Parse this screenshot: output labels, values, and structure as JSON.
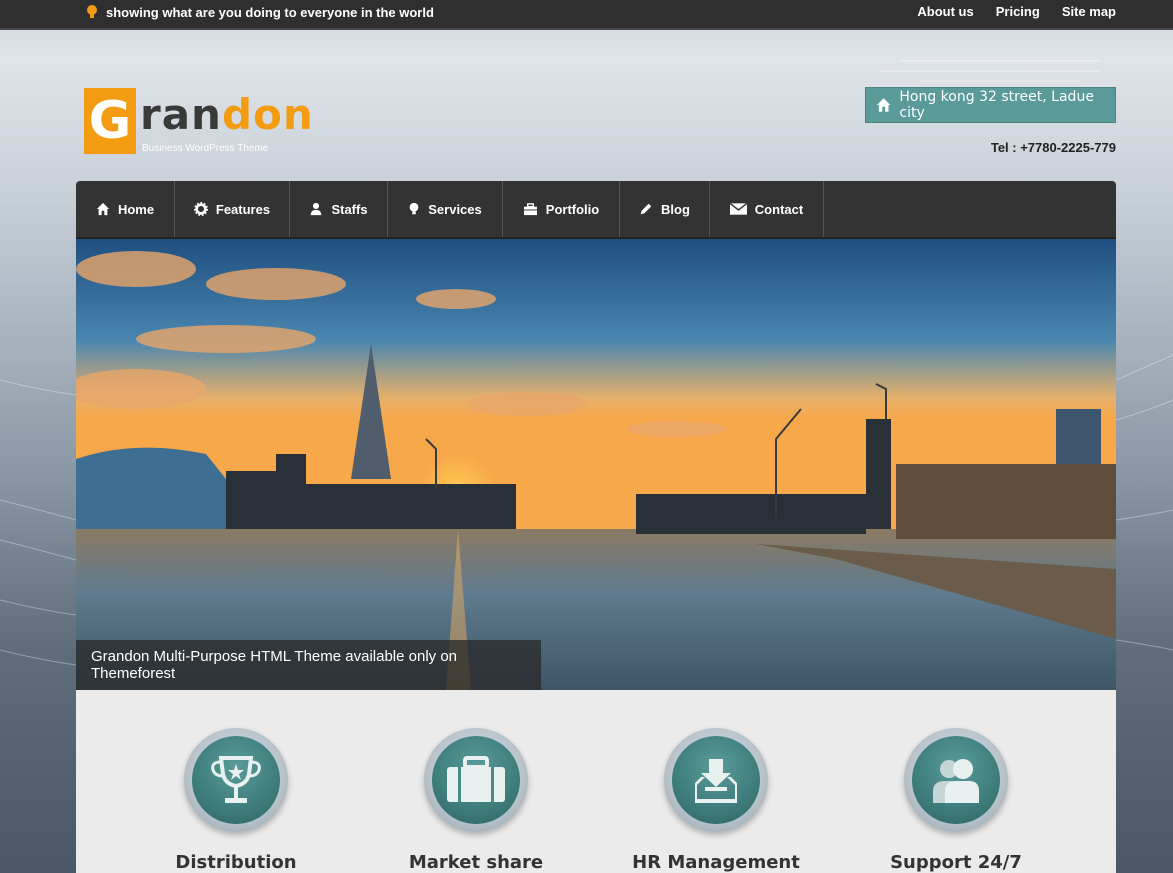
{
  "topbar": {
    "tagline": "showing what are you doing to everyone in the world",
    "links": [
      "About us",
      "Pricing",
      "Site map"
    ]
  },
  "logo": {
    "letter": "G",
    "text_dark": "ran",
    "text_accent": "don",
    "subtitle": "Business WordPress Theme"
  },
  "header": {
    "address": "Hong kong 32 street, Ladue city",
    "tel": "Tel : +7780-2225-779"
  },
  "nav": {
    "items": [
      {
        "label": "Home",
        "icon": "home-icon"
      },
      {
        "label": "Features",
        "icon": "gear-icon"
      },
      {
        "label": "Staffs",
        "icon": "user-icon"
      },
      {
        "label": "Services",
        "icon": "bulb-icon"
      },
      {
        "label": "Portfolio",
        "icon": "briefcase-icon"
      },
      {
        "label": "Blog",
        "icon": "pencil-icon"
      },
      {
        "label": "Contact",
        "icon": "envelope-icon"
      }
    ]
  },
  "hero": {
    "caption": "Grandon Multi-Purpose HTML Theme available only on Themeforest"
  },
  "features": [
    {
      "label": "Distribution",
      "icon": "trophy-icon"
    },
    {
      "label": "Market share",
      "icon": "suitcase-icon"
    },
    {
      "label": "HR Management",
      "icon": "download-tray-icon"
    },
    {
      "label": "Support 24/7",
      "icon": "users-icon"
    }
  ],
  "colors": {
    "accent": "#f39c12",
    "teal": "#5a9a98",
    "dark": "#333333"
  }
}
